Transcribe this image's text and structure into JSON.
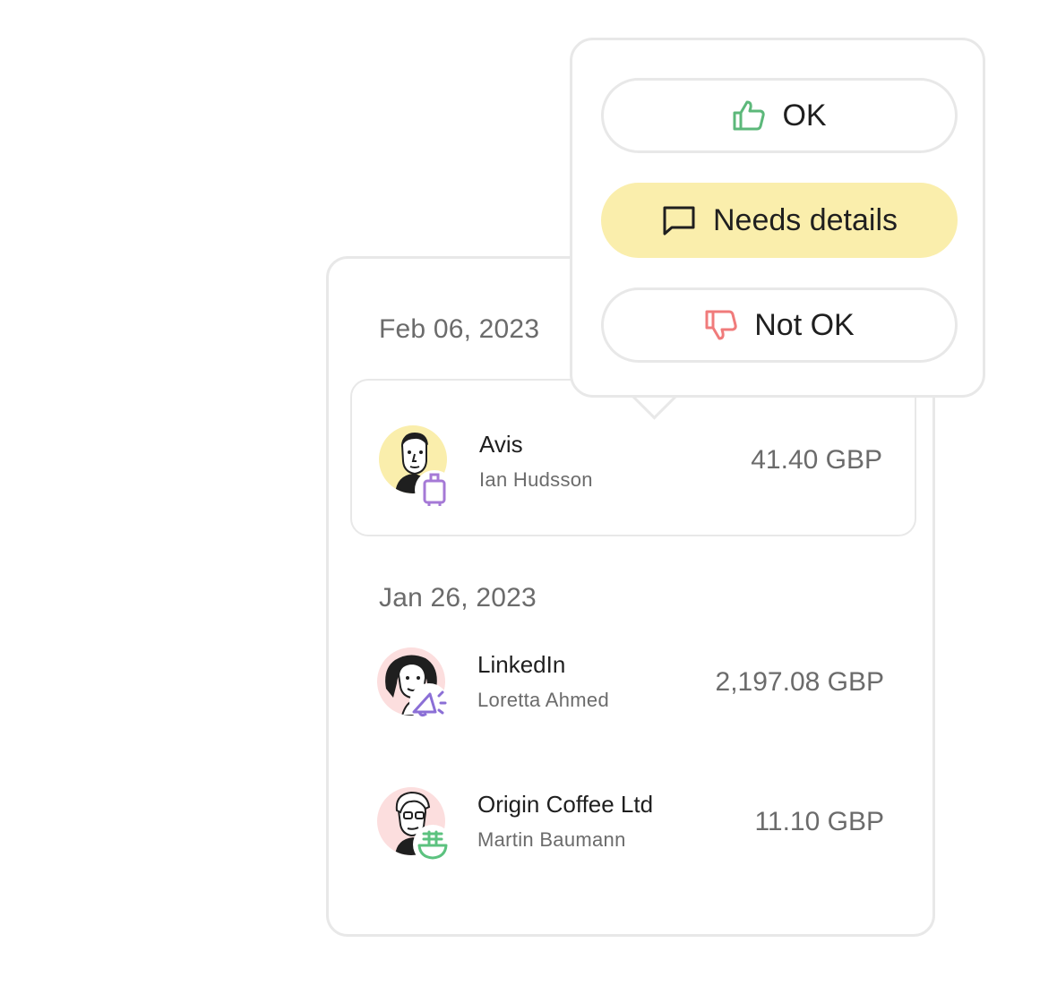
{
  "groups": [
    {
      "date": "Feb 06, 2023",
      "expenses": [
        {
          "merchant": "Avis",
          "person": "Ian Hudsson",
          "amount": "41.40 GBP",
          "category_icon": "luggage-icon",
          "selected": true
        }
      ]
    },
    {
      "date": "Jan 26, 2023",
      "expenses": [
        {
          "merchant": "LinkedIn",
          "person": "Loretta Ahmed",
          "amount": "2,197.08 GBP",
          "category_icon": "megaphone-icon"
        },
        {
          "merchant": "Origin Coffee Ltd",
          "person": "Martin Baumann",
          "amount": "11.10 GBP",
          "category_icon": "food-bowl-icon"
        }
      ]
    }
  ],
  "review_menu": {
    "options": [
      {
        "label": "OK",
        "icon": "thumbs-up-icon"
      },
      {
        "label": "Needs details",
        "icon": "speech-bubble-icon",
        "active": true
      },
      {
        "label": "Not OK",
        "icon": "thumbs-down-icon"
      }
    ]
  },
  "colors": {
    "needs_details_bg": "#faeeac",
    "ok_icon": "#5cb87a",
    "not_ok_icon": "#f07b7b",
    "avatar_yellow": "#faeeac",
    "avatar_pink": "#fcdede",
    "category_purple": "#a579d6",
    "category_green": "#5cc27f"
  }
}
